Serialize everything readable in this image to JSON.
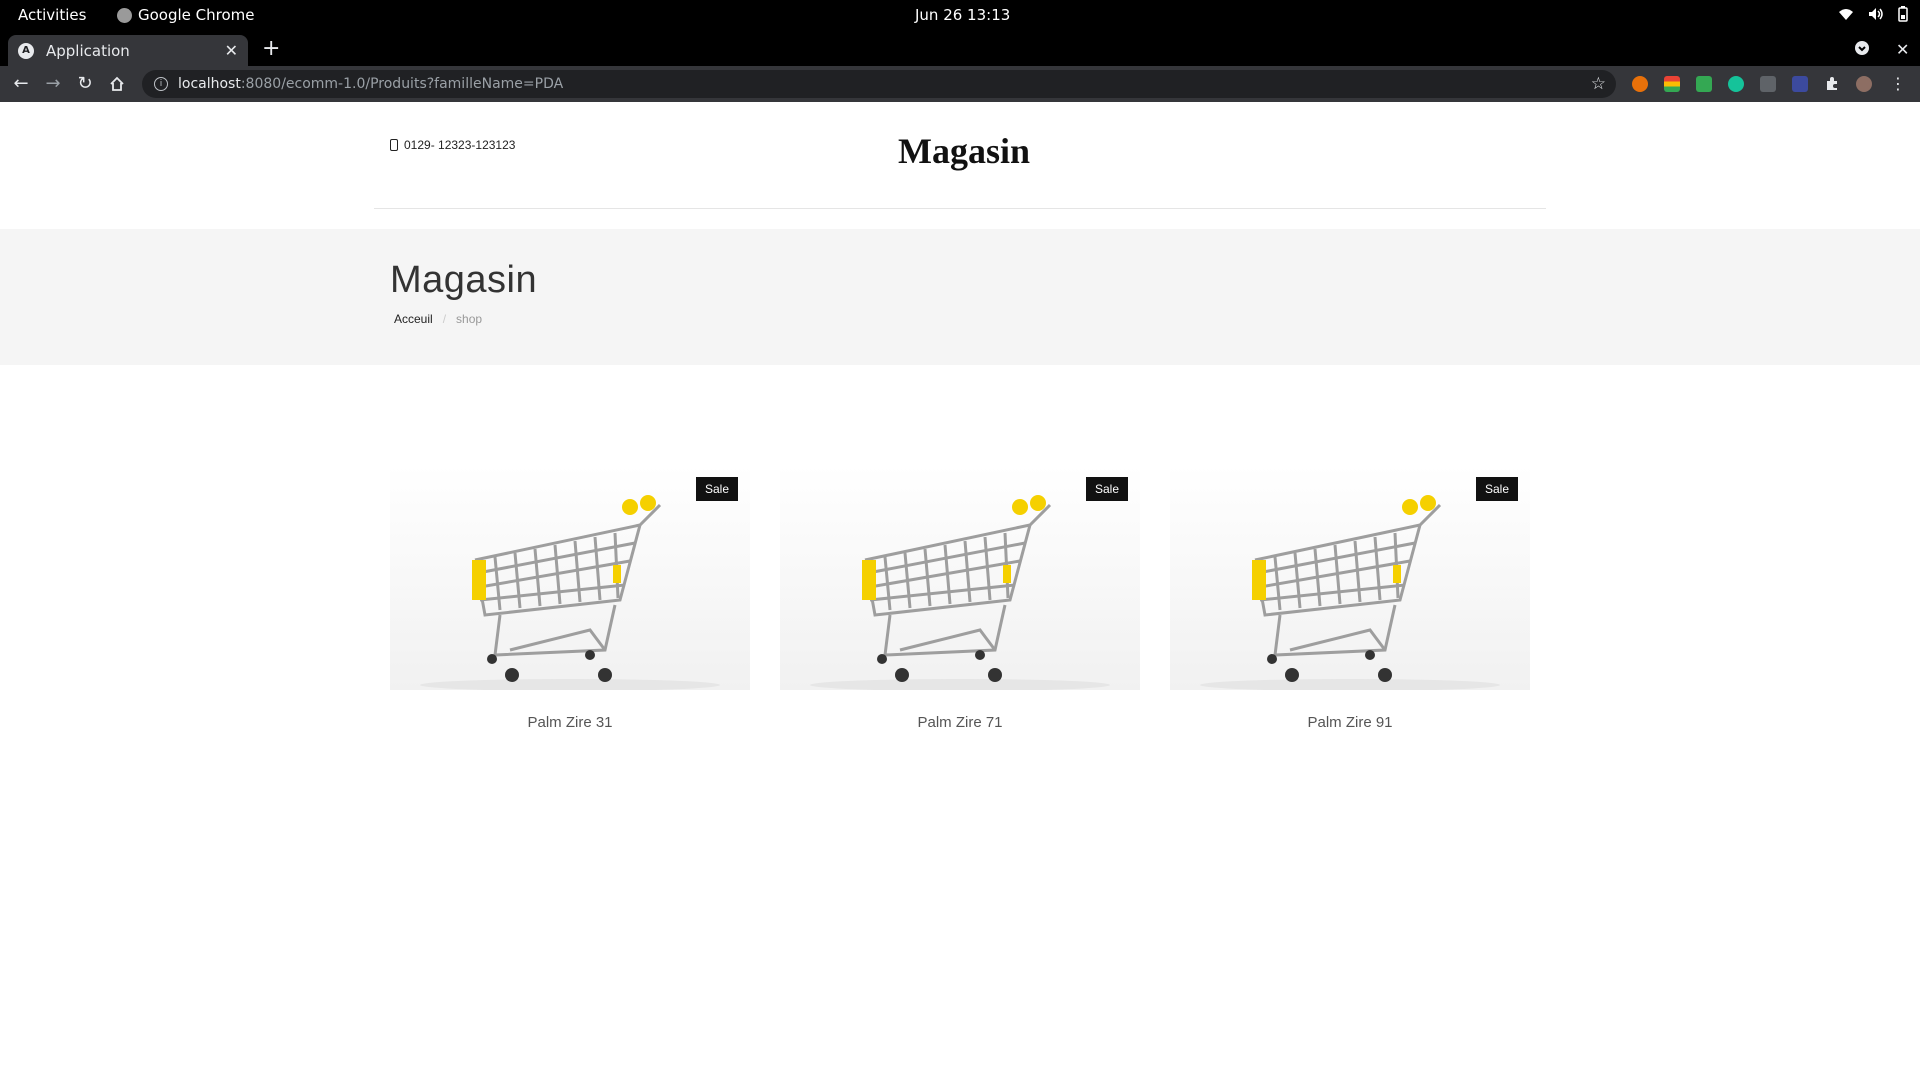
{
  "os": {
    "activities": "Activities",
    "app_name": "Google Chrome",
    "clock": "Jun 26  13:13"
  },
  "browser": {
    "tab_title": "Application",
    "tab_favicon": "A",
    "url_host": "localhost",
    "url_rest": ":8080/ecomm-1.0/Produits?familleName=PDA"
  },
  "header": {
    "phone": "0129- 12323-123123",
    "brand": "Magasin"
  },
  "banner": {
    "title": "Magasin",
    "breadcrumb": [
      {
        "label": "Acceuil"
      },
      {
        "label": "shop"
      }
    ]
  },
  "products": [
    {
      "name": "Palm Zire 31",
      "badge": "Sale"
    },
    {
      "name": "Palm Zire 71",
      "badge": "Sale"
    },
    {
      "name": "Palm Zire 91",
      "badge": "Sale"
    }
  ]
}
